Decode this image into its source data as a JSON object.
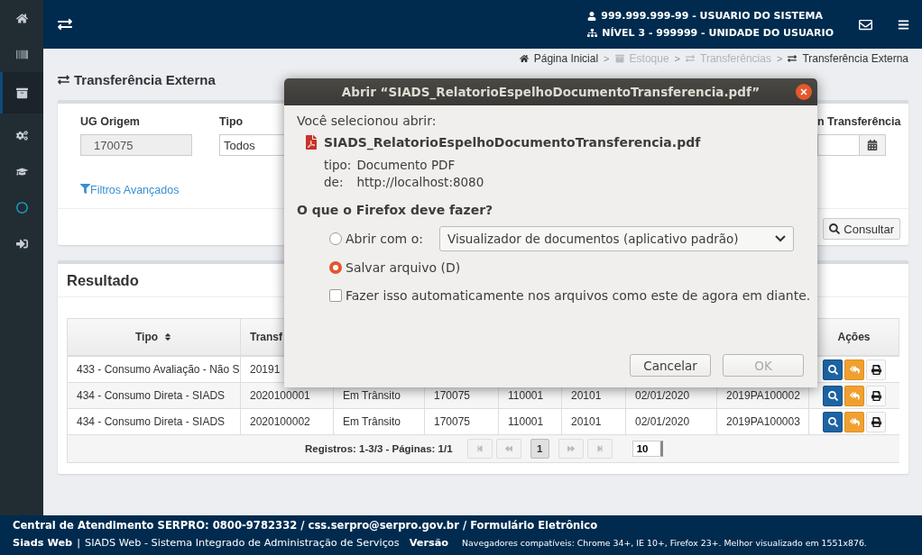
{
  "sidebar": {
    "items": [
      {
        "selected": false
      },
      {
        "selected": false
      },
      {
        "selected": true
      },
      {
        "selected": false
      },
      {
        "selected": false
      },
      {
        "selected": false
      },
      {
        "selected": false
      }
    ]
  },
  "topbar": {
    "user": "999.999.999-99 - USUARIO DO SISTEMA",
    "unit": "NÍVEL 3 - 999999 - UNIDADE DO USUARIO"
  },
  "breadcrumb": [
    {
      "label": "Página Inicial",
      "disabled": false,
      "separator": ">"
    },
    {
      "label": "Estoque",
      "disabled": true,
      "separator": ">"
    },
    {
      "label": "Transferências",
      "disabled": true,
      "separator": ">"
    },
    {
      "label": "Transferência Externa",
      "disabled": false
    }
  ],
  "page_title": "Transferência Externa",
  "filters": {
    "fields": [
      {
        "kind": "text",
        "label": "UG Origem",
        "value": "170075",
        "disabled": true
      },
      {
        "kind": "select",
        "label": "Tipo",
        "value": "Todos"
      },
      {
        "kind": "date",
        "label": "n Transferência"
      }
    ],
    "advanced_link": "Filtros Avançados",
    "search_button": "Consultar"
  },
  "results": {
    "title": "Resultado",
    "columns": [
      {
        "label": "Tipo",
        "sortable": true
      },
      {
        "label": "Transf"
      },
      {},
      {},
      {},
      {},
      {},
      {},
      {
        "label": "Ações",
        "sortable": false
      }
    ],
    "rows": [
      {
        "cells": [
          "433 - Consumo Avaliação - Não S",
          "20191"
        ]
      },
      {
        "cells": [
          "434 - Consumo Direta - SIADS",
          "2020100001",
          "Em Trânsito",
          "170075",
          "110001",
          "20101",
          "02/01/2020",
          "2019PA100002"
        ]
      },
      {
        "cells": [
          "434 - Consumo Direta - SIADS",
          "2020100002",
          "Em Trânsito",
          "170075",
          "110001",
          "20101",
          "02/01/2020",
          "2019PA100003"
        ]
      }
    ],
    "pagination": {
      "summary": "Registros: 1-3/3 - Páginas: 1/1",
      "pages": [
        {
          "label": "1",
          "selected": true
        }
      ],
      "page_size": "10"
    }
  },
  "dialog": {
    "title": "Abrir “SIADS_RelatorioEspelhoDocumentoTransferencia.pdf”",
    "intro": "Você selecionou abrir:",
    "filename": "SIADS_RelatorioEspelhoDocumentoTransferencia.pdf",
    "type_label": "tipo:",
    "type_value": "Documento PDF",
    "from_label": "de:",
    "from_value": "http://localhost:8080",
    "question": "O que o Firefox deve fazer?",
    "options": [
      {
        "label": "Abrir com o:",
        "selected": false
      },
      {
        "label": "Salvar arquivo (D)",
        "selected": true
      }
    ],
    "app_select": "Visualizador de documentos (aplicativo padrão)",
    "remember": {
      "label": "Fazer isso automaticamente nos arquivos como este de agora em diante.",
      "checked": false
    },
    "buttons": [
      {
        "label": "Cancelar",
        "disabled": false
      },
      {
        "label": "OK",
        "disabled": true
      }
    ]
  },
  "footer": {
    "contact": "Central de Atendimento SERPRO: 0800-9782332 / css.serpro@serpro.gov.br / Formulário Eletrônico",
    "brand": "Siads Web",
    "separator": "|",
    "system": "SIADS Web - Sistema Integrado de Administração de Serviços",
    "version_label": "Versão",
    "browsers": "Navegadores compatíveis: Chrome 34+, IE 10+, Firefox 23+. Melhor visualizado em 1551x876."
  }
}
